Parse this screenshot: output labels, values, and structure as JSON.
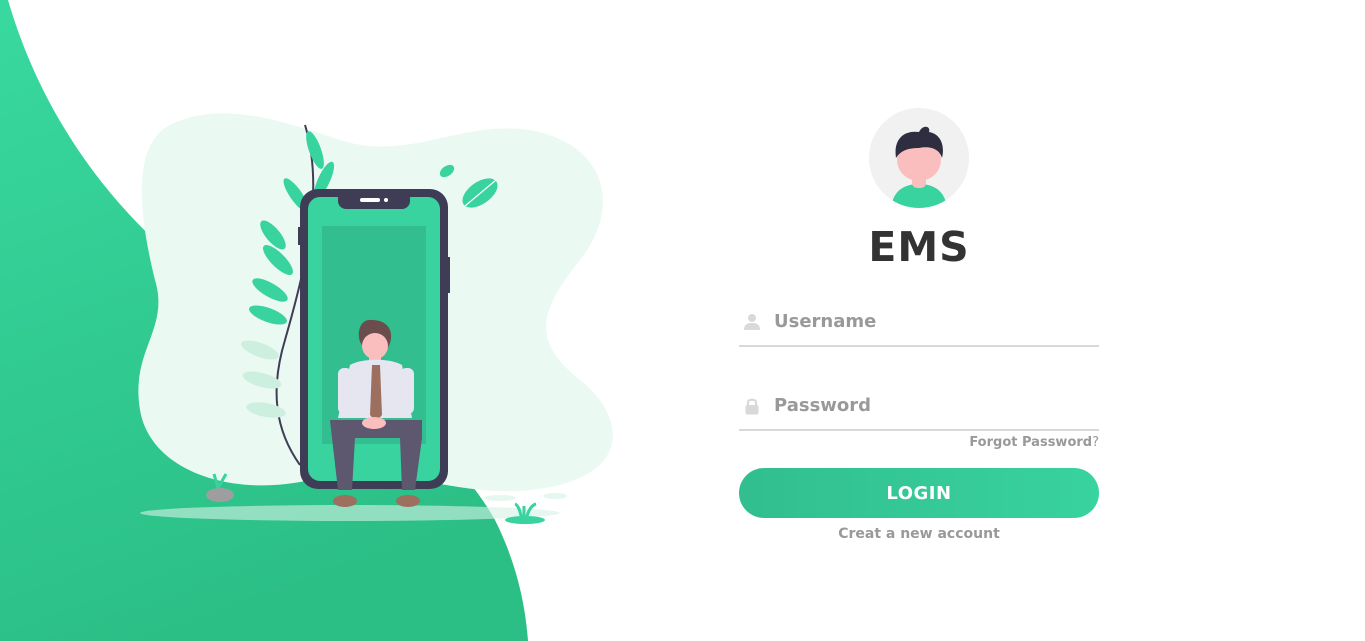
{
  "app": {
    "title": "EMS"
  },
  "form": {
    "username_placeholder": "Username",
    "password_placeholder": "Password",
    "forgot_label": "Forgot Password",
    "forgot_suffix": "?",
    "login_label": "LOGIN",
    "create_account_label": "Creat a new account"
  },
  "icons": {
    "username": "user-icon",
    "password": "lock-icon",
    "avatar": "user-avatar-icon"
  },
  "colors": {
    "accent": "#38d39f",
    "accent_dark": "#32be8f",
    "title": "#333333",
    "muted": "#999999",
    "input_border": "#d9d9d9"
  }
}
